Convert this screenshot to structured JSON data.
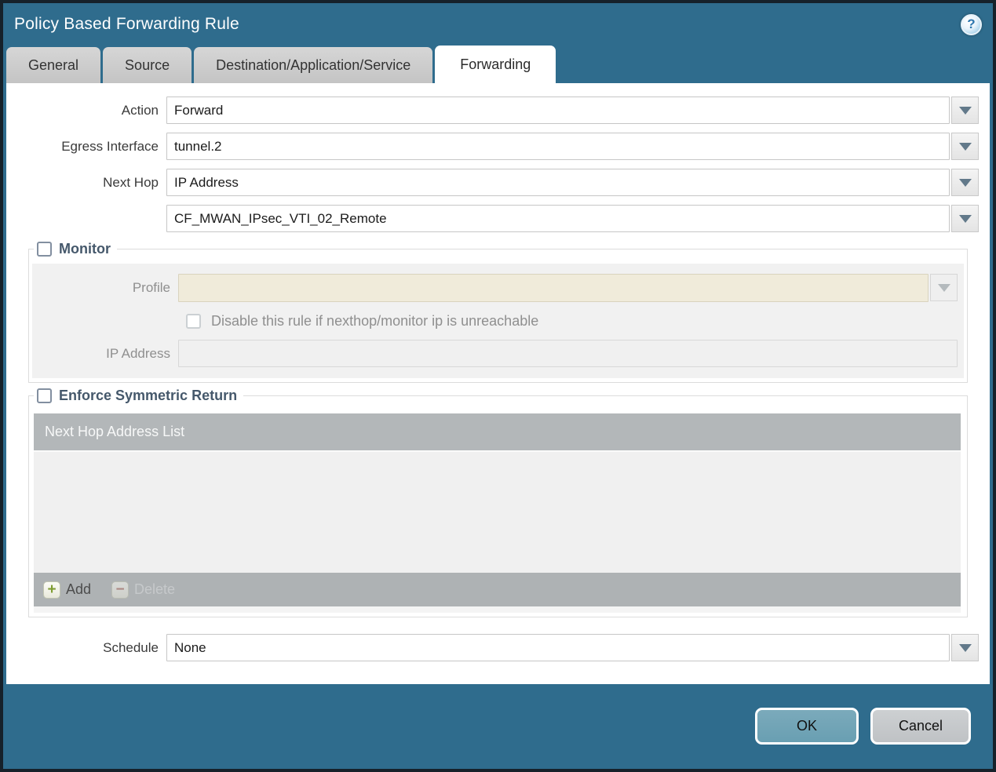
{
  "dialog": {
    "title": "Policy Based Forwarding Rule",
    "help_glyph": "?"
  },
  "tabs": [
    {
      "label": "General",
      "active": false
    },
    {
      "label": "Source",
      "active": false
    },
    {
      "label": "Destination/Application/Service",
      "active": false
    },
    {
      "label": "Forwarding",
      "active": true
    }
  ],
  "form": {
    "action": {
      "label": "Action",
      "value": "Forward"
    },
    "egress_interface": {
      "label": "Egress Interface",
      "value": "tunnel.2"
    },
    "next_hop": {
      "label": "Next Hop",
      "value": "IP Address"
    },
    "next_hop_address": {
      "value": "CF_MWAN_IPsec_VTI_02_Remote"
    },
    "schedule": {
      "label": "Schedule",
      "value": "None"
    }
  },
  "monitor": {
    "title": "Monitor",
    "checked": false,
    "profile_label": "Profile",
    "profile_value": "",
    "disable_checkbox_label": "Disable this rule if nexthop/monitor ip is unreachable",
    "disable_checked": false,
    "ip_address_label": "IP Address",
    "ip_address_value": ""
  },
  "symmetric_return": {
    "title": "Enforce Symmetric Return",
    "checked": false,
    "table_header": "Next Hop Address List",
    "rows": [],
    "add_label": "Add",
    "delete_label": "Delete",
    "delete_enabled": false
  },
  "footer": {
    "ok_label": "OK",
    "cancel_label": "Cancel"
  },
  "icons": {
    "plus": "+",
    "minus": "−"
  },
  "colors": {
    "chrome_teal": "#2F6C8D",
    "outer_border": "#16212A",
    "inactive_tab": "#C9C9C9",
    "section_title": "#45586B",
    "disabled_field_beige": "#F0EBDA",
    "table_header_gray": "#B3B7B9",
    "table_footer_gray": "#AEB2B4",
    "add_plus_green": "#7E9C31",
    "delete_minus_red": "#A9685C",
    "ok_button": "#6FA3B5",
    "cancel_button": "#C3C6C9"
  }
}
